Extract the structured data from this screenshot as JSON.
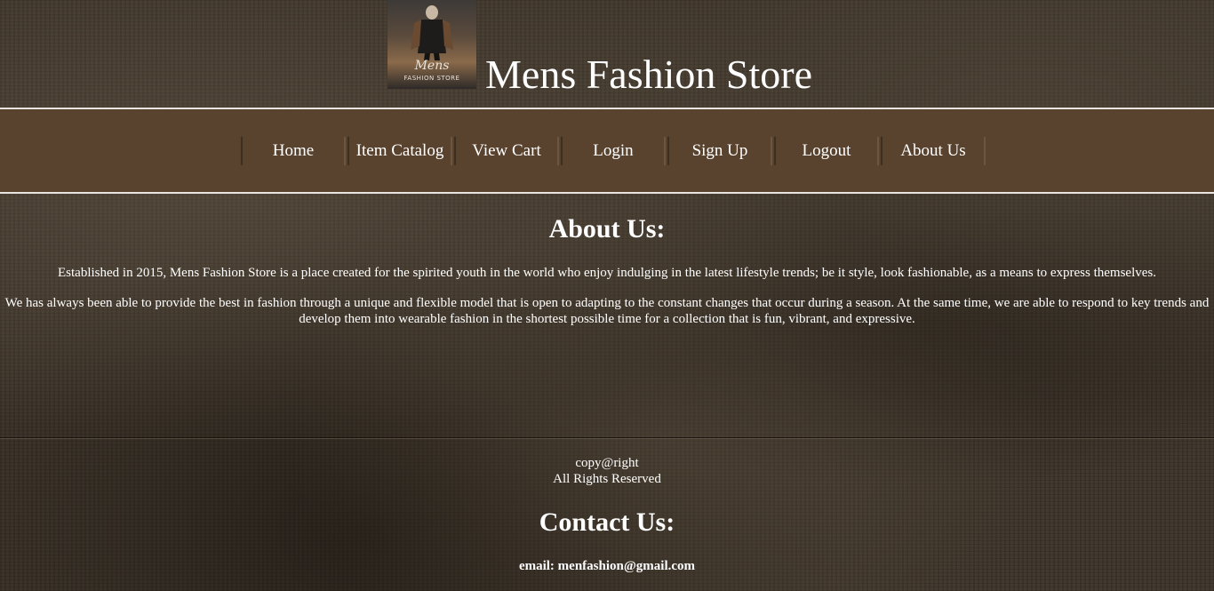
{
  "header": {
    "logo": {
      "icon": "store-logo",
      "line1": "Mens",
      "line2": "FASHION STORE"
    },
    "title": "Mens Fashion Store"
  },
  "nav": {
    "items": [
      {
        "label": "Home"
      },
      {
        "label": "Item Catalog"
      },
      {
        "label": "View Cart"
      },
      {
        "label": "Login"
      },
      {
        "label": "Sign Up"
      },
      {
        "label": "Logout"
      },
      {
        "label": "About Us"
      }
    ]
  },
  "about": {
    "title": "About Us:",
    "paragraph1": "Established in 2015, Mens Fashion Store is a place created for the spirited youth in the world who enjoy indulging in the latest lifestyle trends; be it style, look fashionable, as a means to express themselves.",
    "paragraph2": "We has always been able to provide the best in fashion through a unique and flexible model that is open to adapting to the constant changes that occur during a season. At the same time, we are able to respond to key trends and develop them into wearable fashion in the shortest possible time for a collection that is fun, vibrant, and expressive."
  },
  "footer": {
    "copyright": "copy@right",
    "rights": "All Rights Reserved",
    "contact_title": "Contact Us:",
    "email": "email: menfashion@gmail.com"
  },
  "colors": {
    "navbar": "#59432f",
    "background": "#3a3127",
    "text": "#ffffff"
  }
}
